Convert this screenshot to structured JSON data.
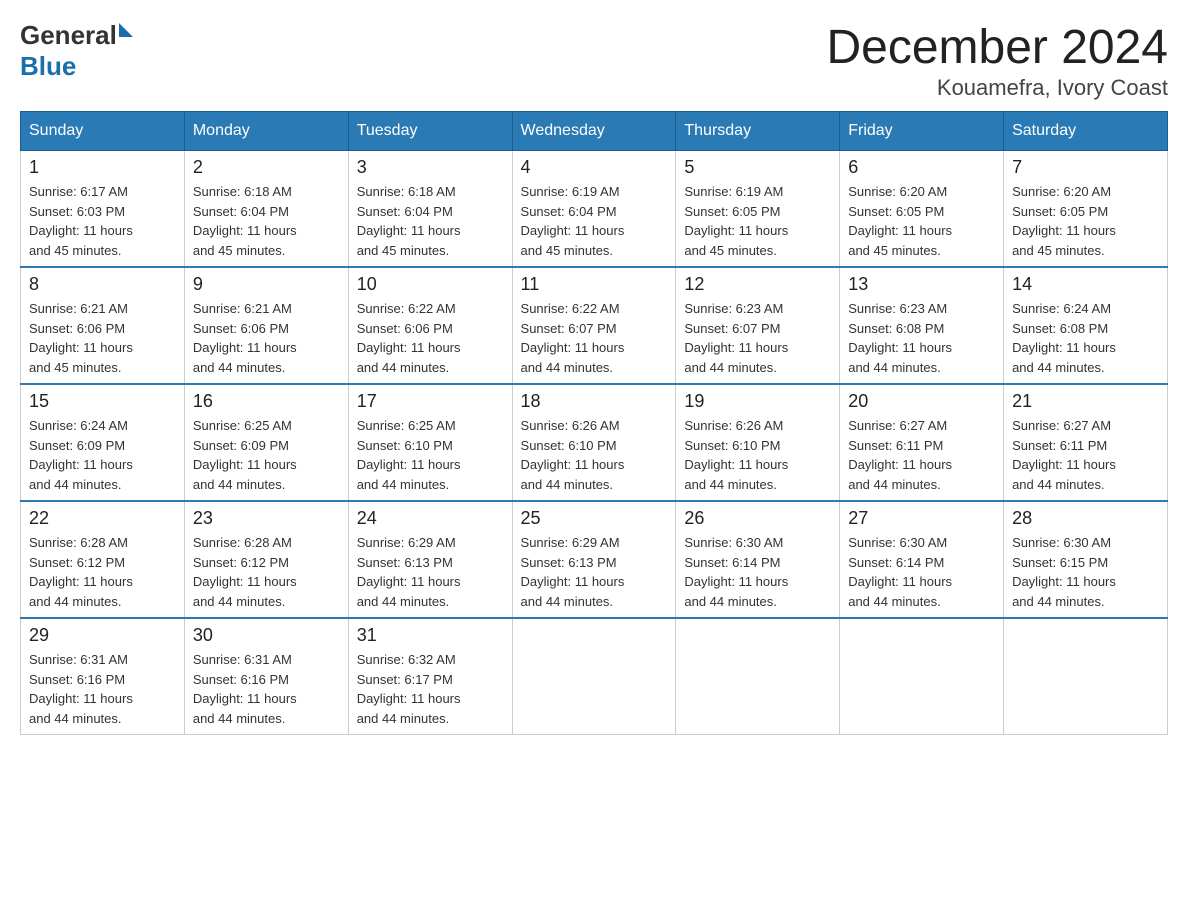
{
  "header": {
    "logo_general": "General",
    "logo_blue": "Blue",
    "title": "December 2024",
    "subtitle": "Kouamefra, Ivory Coast"
  },
  "days": [
    "Sunday",
    "Monday",
    "Tuesday",
    "Wednesday",
    "Thursday",
    "Friday",
    "Saturday"
  ],
  "weeks": [
    [
      {
        "date": "1",
        "sunrise": "6:17 AM",
        "sunset": "6:03 PM",
        "daylight": "11 hours and 45 minutes."
      },
      {
        "date": "2",
        "sunrise": "6:18 AM",
        "sunset": "6:04 PM",
        "daylight": "11 hours and 45 minutes."
      },
      {
        "date": "3",
        "sunrise": "6:18 AM",
        "sunset": "6:04 PM",
        "daylight": "11 hours and 45 minutes."
      },
      {
        "date": "4",
        "sunrise": "6:19 AM",
        "sunset": "6:04 PM",
        "daylight": "11 hours and 45 minutes."
      },
      {
        "date": "5",
        "sunrise": "6:19 AM",
        "sunset": "6:05 PM",
        "daylight": "11 hours and 45 minutes."
      },
      {
        "date": "6",
        "sunrise": "6:20 AM",
        "sunset": "6:05 PM",
        "daylight": "11 hours and 45 minutes."
      },
      {
        "date": "7",
        "sunrise": "6:20 AM",
        "sunset": "6:05 PM",
        "daylight": "11 hours and 45 minutes."
      }
    ],
    [
      {
        "date": "8",
        "sunrise": "6:21 AM",
        "sunset": "6:06 PM",
        "daylight": "11 hours and 45 minutes."
      },
      {
        "date": "9",
        "sunrise": "6:21 AM",
        "sunset": "6:06 PM",
        "daylight": "11 hours and 44 minutes."
      },
      {
        "date": "10",
        "sunrise": "6:22 AM",
        "sunset": "6:06 PM",
        "daylight": "11 hours and 44 minutes."
      },
      {
        "date": "11",
        "sunrise": "6:22 AM",
        "sunset": "6:07 PM",
        "daylight": "11 hours and 44 minutes."
      },
      {
        "date": "12",
        "sunrise": "6:23 AM",
        "sunset": "6:07 PM",
        "daylight": "11 hours and 44 minutes."
      },
      {
        "date": "13",
        "sunrise": "6:23 AM",
        "sunset": "6:08 PM",
        "daylight": "11 hours and 44 minutes."
      },
      {
        "date": "14",
        "sunrise": "6:24 AM",
        "sunset": "6:08 PM",
        "daylight": "11 hours and 44 minutes."
      }
    ],
    [
      {
        "date": "15",
        "sunrise": "6:24 AM",
        "sunset": "6:09 PM",
        "daylight": "11 hours and 44 minutes."
      },
      {
        "date": "16",
        "sunrise": "6:25 AM",
        "sunset": "6:09 PM",
        "daylight": "11 hours and 44 minutes."
      },
      {
        "date": "17",
        "sunrise": "6:25 AM",
        "sunset": "6:10 PM",
        "daylight": "11 hours and 44 minutes."
      },
      {
        "date": "18",
        "sunrise": "6:26 AM",
        "sunset": "6:10 PM",
        "daylight": "11 hours and 44 minutes."
      },
      {
        "date": "19",
        "sunrise": "6:26 AM",
        "sunset": "6:10 PM",
        "daylight": "11 hours and 44 minutes."
      },
      {
        "date": "20",
        "sunrise": "6:27 AM",
        "sunset": "6:11 PM",
        "daylight": "11 hours and 44 minutes."
      },
      {
        "date": "21",
        "sunrise": "6:27 AM",
        "sunset": "6:11 PM",
        "daylight": "11 hours and 44 minutes."
      }
    ],
    [
      {
        "date": "22",
        "sunrise": "6:28 AM",
        "sunset": "6:12 PM",
        "daylight": "11 hours and 44 minutes."
      },
      {
        "date": "23",
        "sunrise": "6:28 AM",
        "sunset": "6:12 PM",
        "daylight": "11 hours and 44 minutes."
      },
      {
        "date": "24",
        "sunrise": "6:29 AM",
        "sunset": "6:13 PM",
        "daylight": "11 hours and 44 minutes."
      },
      {
        "date": "25",
        "sunrise": "6:29 AM",
        "sunset": "6:13 PM",
        "daylight": "11 hours and 44 minutes."
      },
      {
        "date": "26",
        "sunrise": "6:30 AM",
        "sunset": "6:14 PM",
        "daylight": "11 hours and 44 minutes."
      },
      {
        "date": "27",
        "sunrise": "6:30 AM",
        "sunset": "6:14 PM",
        "daylight": "11 hours and 44 minutes."
      },
      {
        "date": "28",
        "sunrise": "6:30 AM",
        "sunset": "6:15 PM",
        "daylight": "11 hours and 44 minutes."
      }
    ],
    [
      {
        "date": "29",
        "sunrise": "6:31 AM",
        "sunset": "6:16 PM",
        "daylight": "11 hours and 44 minutes."
      },
      {
        "date": "30",
        "sunrise": "6:31 AM",
        "sunset": "6:16 PM",
        "daylight": "11 hours and 44 minutes."
      },
      {
        "date": "31",
        "sunrise": "6:32 AM",
        "sunset": "6:17 PM",
        "daylight": "11 hours and 44 minutes."
      },
      null,
      null,
      null,
      null
    ]
  ],
  "labels": {
    "sunrise": "Sunrise:",
    "sunset": "Sunset:",
    "daylight": "Daylight:"
  }
}
